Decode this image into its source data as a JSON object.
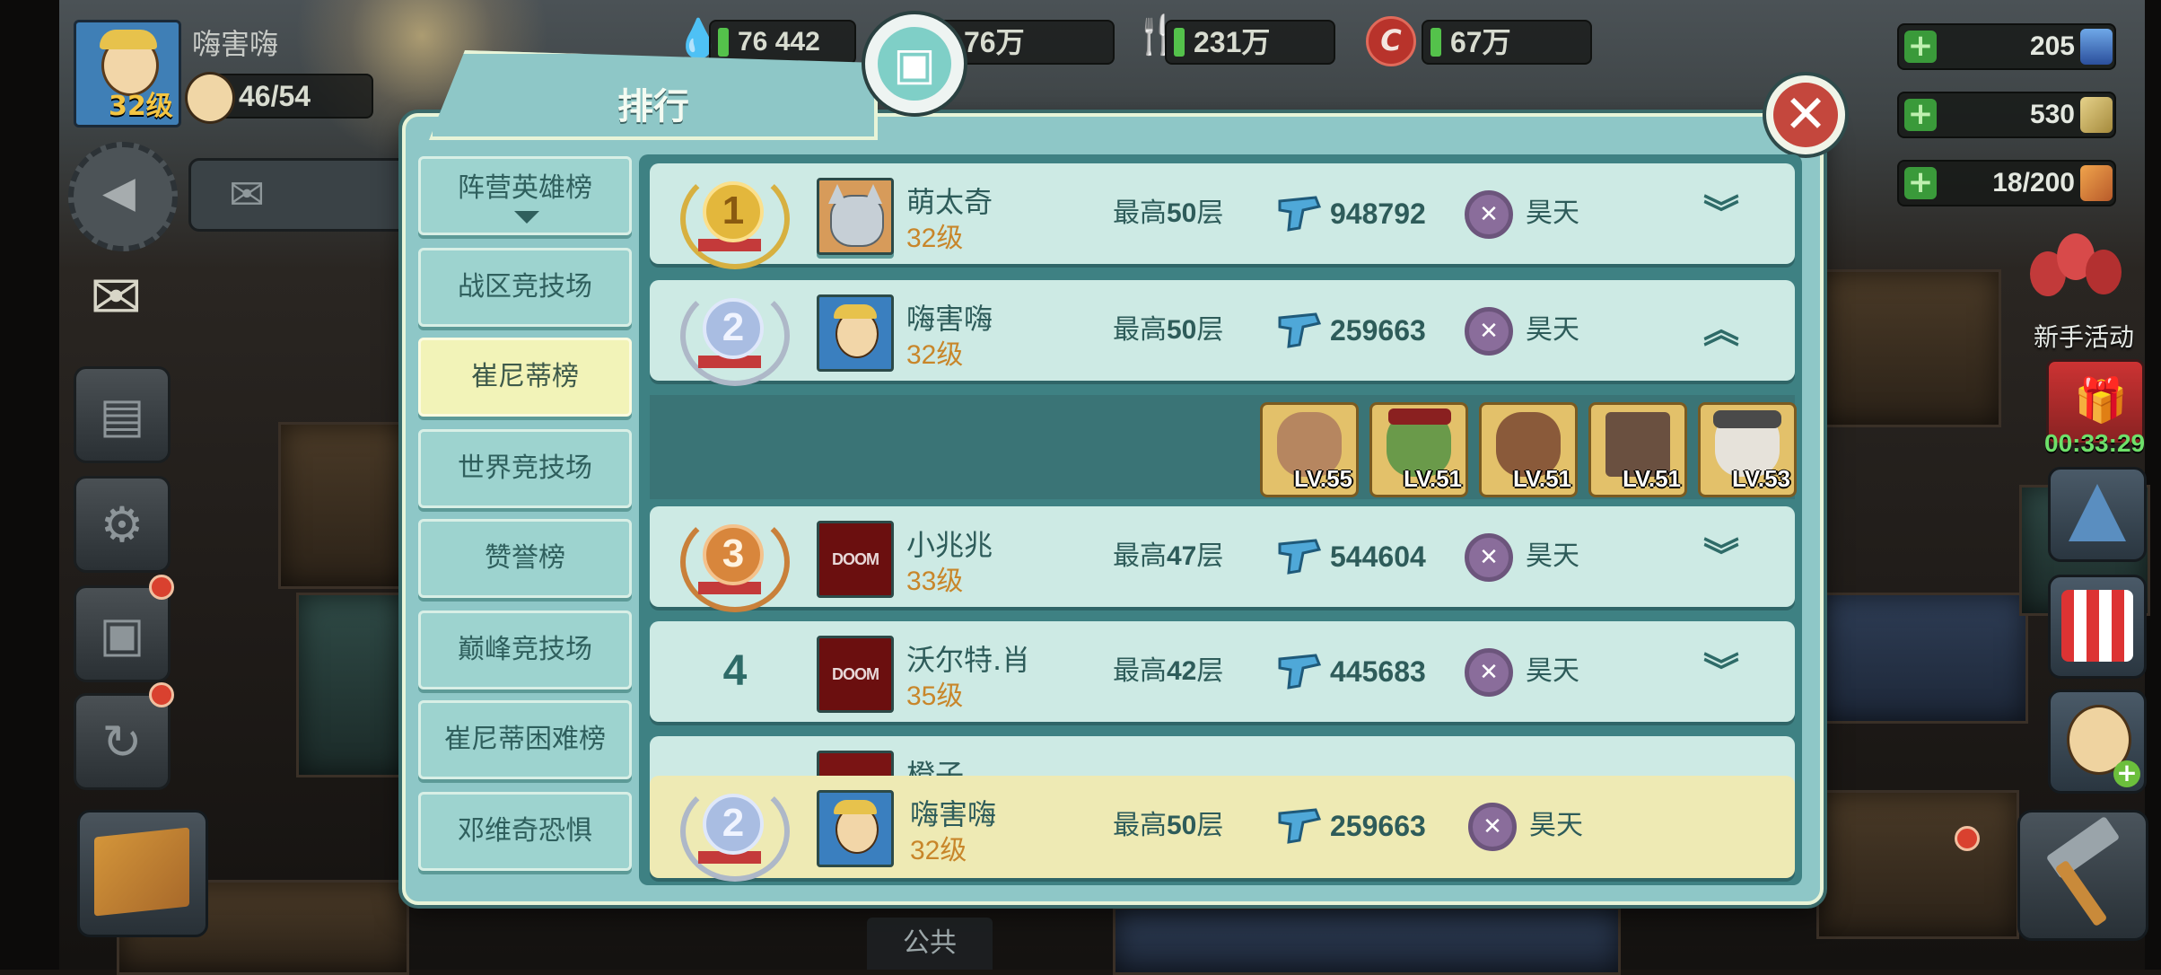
{
  "player": {
    "name": "嗨害嗨",
    "level": "32级",
    "dwellers": "46/54"
  },
  "resources": {
    "water": "76 442",
    "power": "76万",
    "food": "231万",
    "caps": "67万"
  },
  "right_items": [
    {
      "value": "205",
      "icon": "nuka-quantum-icon"
    },
    {
      "value": "530",
      "icon": "stimpak-icon"
    },
    {
      "value": "18/200",
      "icon": "radaway-icon"
    }
  ],
  "event": {
    "label": "新手活动",
    "timer": "00:33:29"
  },
  "bottom": {
    "chat_tab": "公共"
  },
  "panel": {
    "title": "排行",
    "categories": [
      {
        "label": "阵营英雄榜"
      },
      {
        "label": "战区竞技场"
      },
      {
        "label": "崔尼蒂榜"
      },
      {
        "label": "世界竞技场"
      },
      {
        "label": "赞誉榜"
      },
      {
        "label": "巅峰竞技场"
      },
      {
        "label": "崔尼蒂困难榜"
      },
      {
        "label": "邓维奇恐惧"
      }
    ],
    "rows": [
      {
        "rank": "1",
        "name": "萌太奇",
        "level": "32级",
        "floor_prefix": "最高",
        "floor_num": "50",
        "floor_suffix": "层",
        "power": "948792",
        "guild": "昊天"
      },
      {
        "rank": "2",
        "name": "嗨害嗨",
        "level": "32级",
        "floor_prefix": "最高",
        "floor_num": "50",
        "floor_suffix": "层",
        "power": "259663",
        "guild": "昊天"
      },
      {
        "rank": "3",
        "name": "小兆兆",
        "level": "33级",
        "floor_prefix": "最高",
        "floor_num": "47",
        "floor_suffix": "层",
        "power": "544604",
        "guild": "昊天"
      },
      {
        "rank": "4",
        "name": "沃尔特.肖",
        "level": "35级",
        "floor_prefix": "最高",
        "floor_num": "42",
        "floor_suffix": "层",
        "power": "445683",
        "guild": "昊天"
      },
      {
        "name": "橙子"
      }
    ],
    "team_levels": [
      "LV.55",
      "LV.51",
      "LV.51",
      "LV.51",
      "LV.53"
    ],
    "my_row": {
      "rank": "2",
      "name": "嗨害嗨",
      "level": "32级",
      "floor_prefix": "最高",
      "floor_num": "50",
      "floor_suffix": "层",
      "power": "259663",
      "guild": "昊天"
    },
    "doom_text": "DOOM"
  }
}
